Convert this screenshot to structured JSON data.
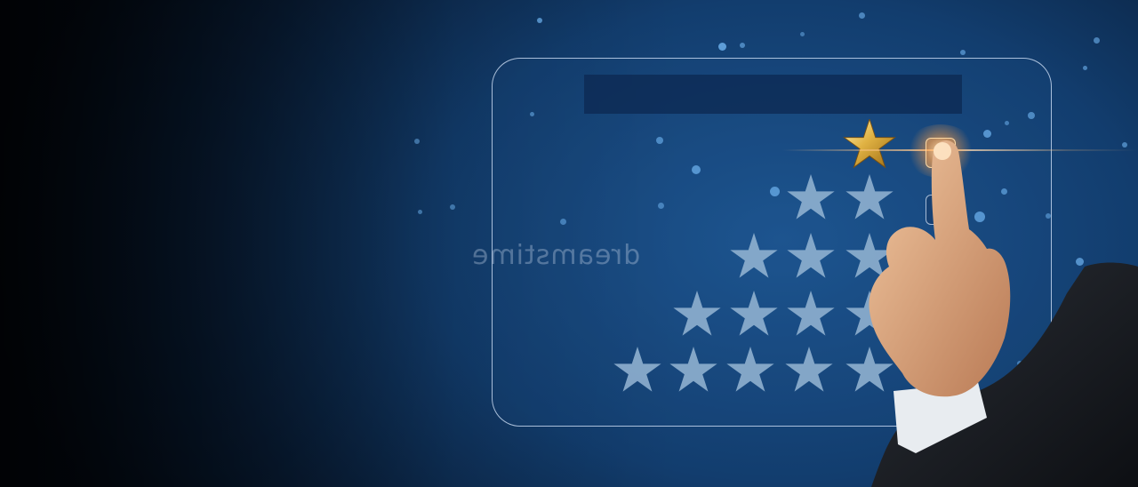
{
  "watermark": "dreamstime",
  "colors": {
    "background": "#123d6e",
    "panel_border": "#dcebff",
    "empty_star": "#8fb0cf",
    "gold_star": "#d9a93a",
    "glow": "#ffb870"
  },
  "rating": {
    "max": 5,
    "selected": 5,
    "icon": "gold-star-icon",
    "row_icon": "empty-star-icon"
  },
  "checkbox_rows": 5
}
